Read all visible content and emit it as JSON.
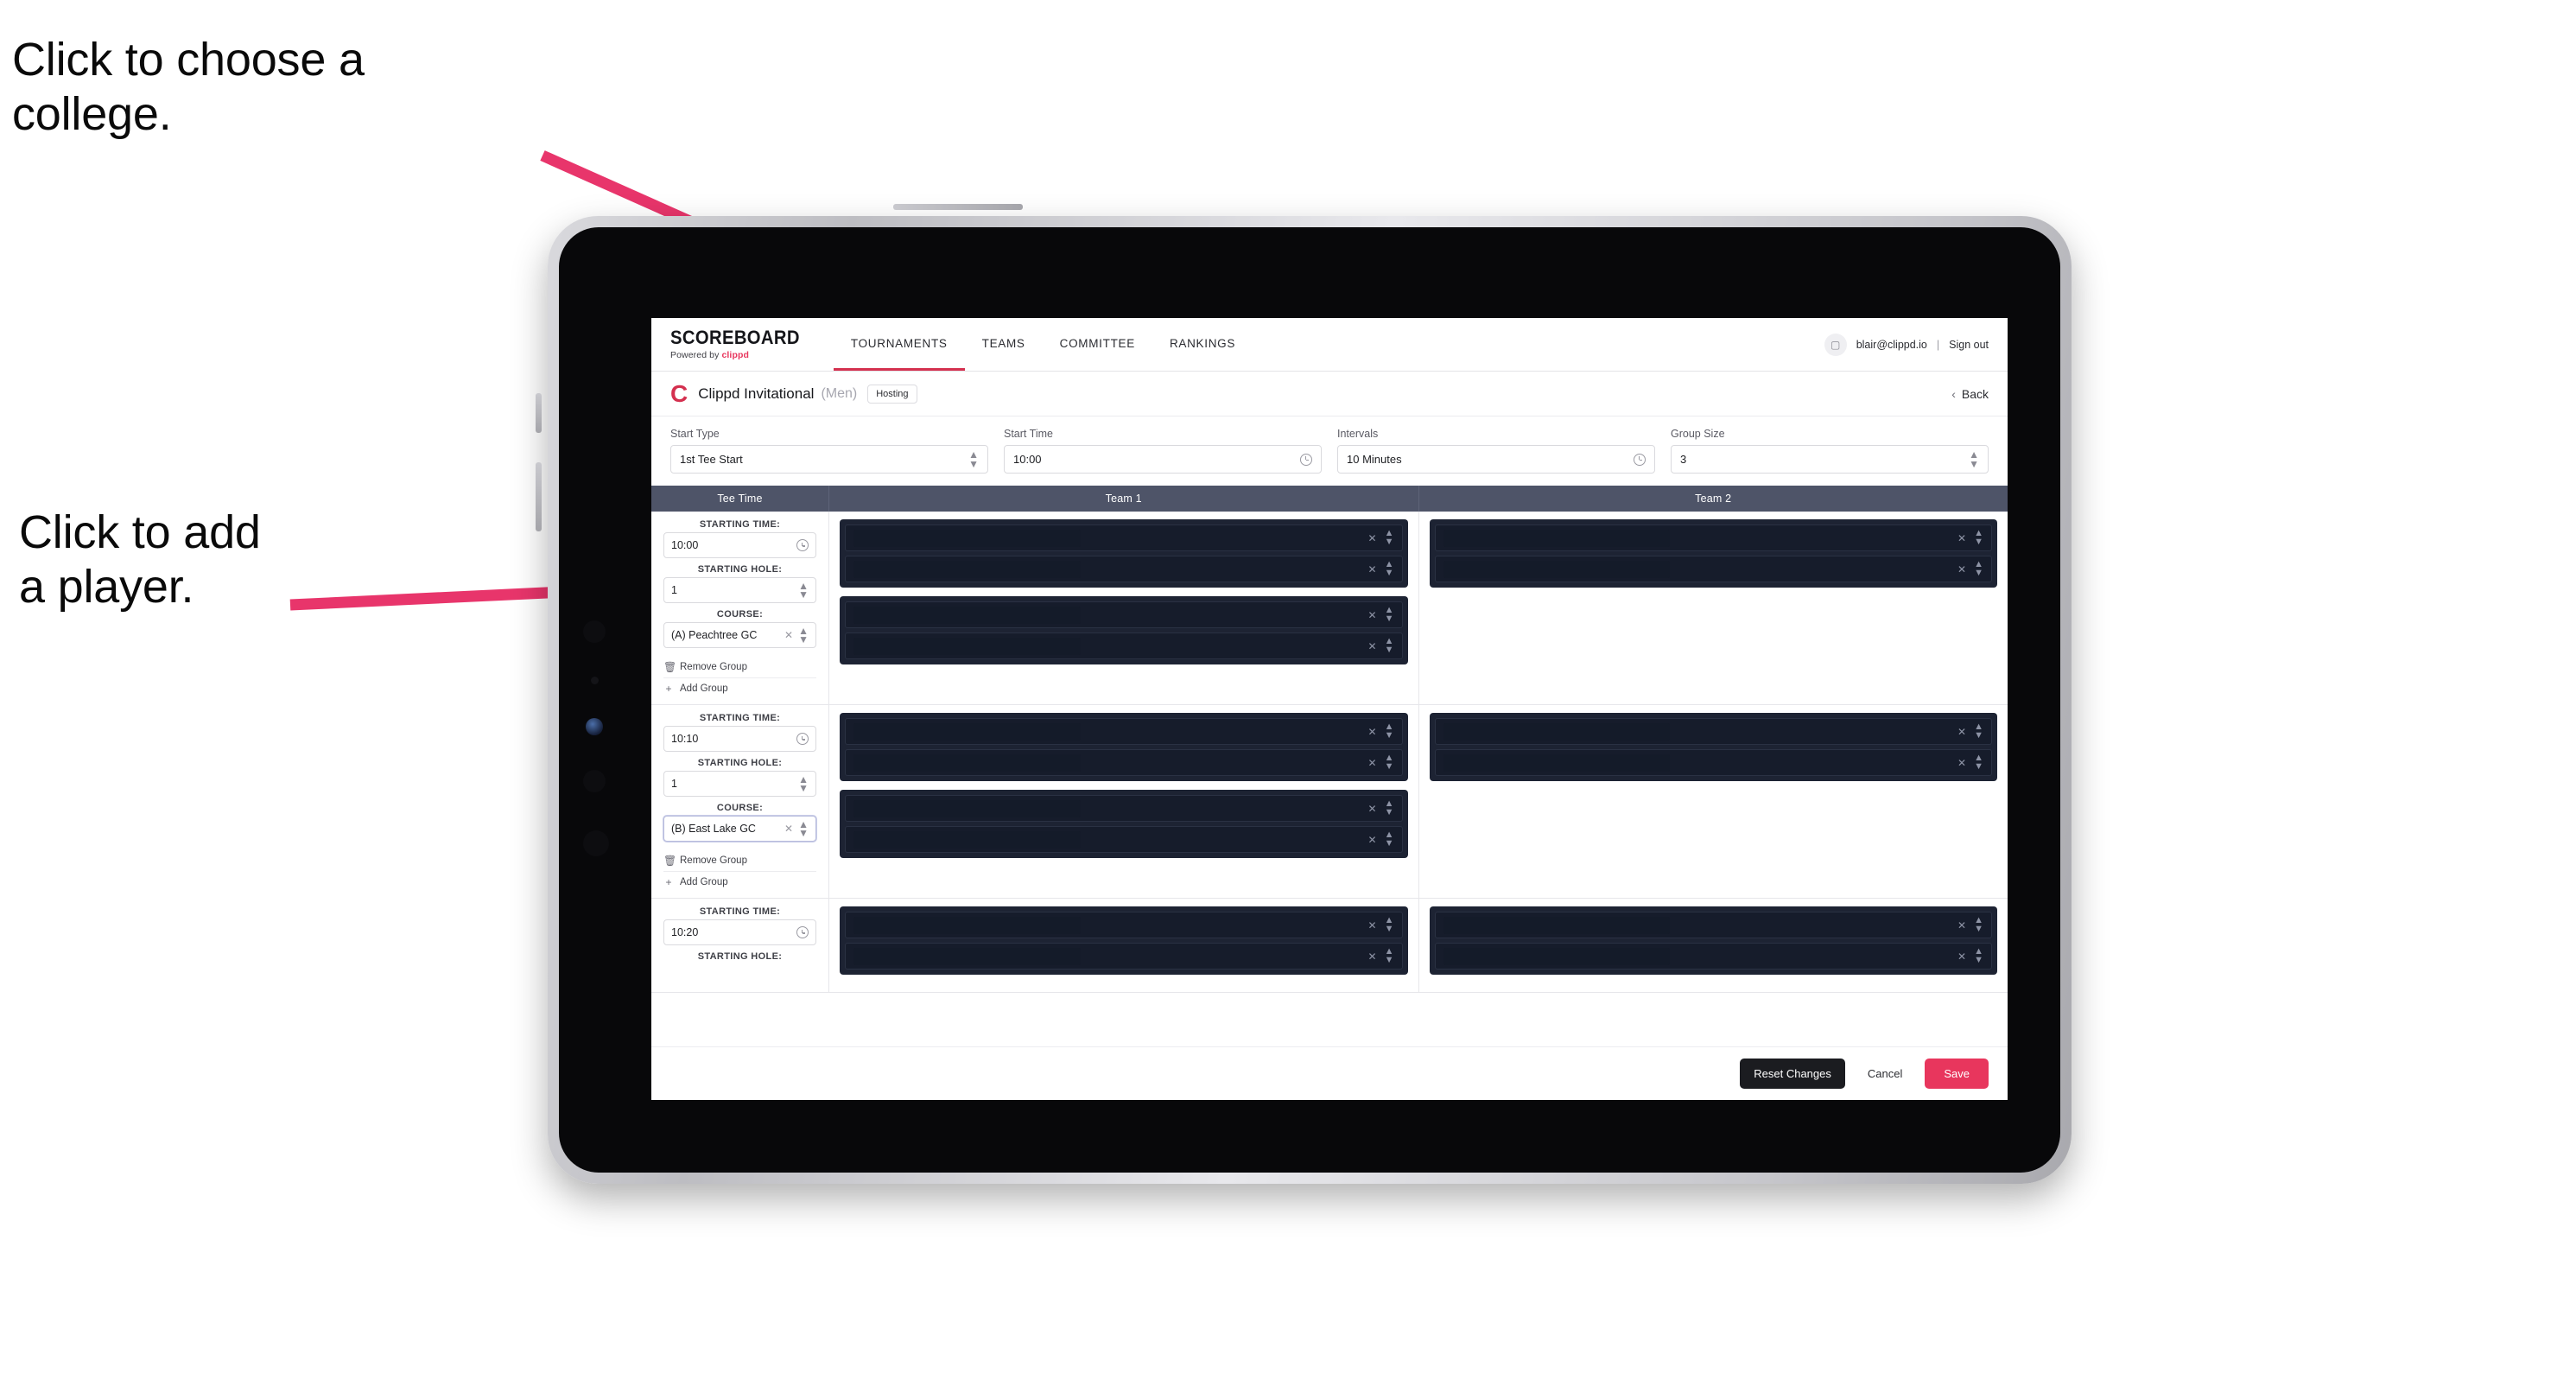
{
  "annotations": [
    {
      "id": "college",
      "text": "Click to choose a\ncollege."
    },
    {
      "id": "player",
      "text": "Click to add\na player."
    }
  ],
  "colors": {
    "accent": "#e8365d",
    "nav_active_underline": "#d4304f",
    "table_header_bg": "#4e5468",
    "slot_bg": "#1d2333",
    "save_button": "#e8365d",
    "reset_button": "#1b1c20",
    "arrow": "#e8356b"
  },
  "topnav": {
    "brand_word": "SCOREBOARD",
    "brand_sub_prefix": "Powered by ",
    "brand_sub_name": "clippd",
    "tabs": [
      {
        "label": "TOURNAMENTS",
        "active": true
      },
      {
        "label": "TEAMS",
        "active": false
      },
      {
        "label": "COMMITTEE",
        "active": false
      },
      {
        "label": "RANKINGS",
        "active": false
      }
    ],
    "avatar_icon": "user-avatar-icon",
    "email": "blair@clippd.io",
    "separator": "|",
    "sign_out": "Sign out"
  },
  "title_row": {
    "logo_letter": "C",
    "tournament_name": "Clippd Invitational",
    "gender": "(Men)",
    "role_chip": "Hosting",
    "back_chevron": "‹",
    "back_label": "Back"
  },
  "controls": [
    {
      "label": "Start Type",
      "value": "1st Tee Start",
      "affix": "stepper"
    },
    {
      "label": "Start Time",
      "value": "10:00",
      "affix": "clock"
    },
    {
      "label": "Intervals",
      "value": "10 Minutes",
      "affix": "clock"
    },
    {
      "label": "Group Size",
      "value": "3",
      "affix": "stepper"
    }
  ],
  "table": {
    "columns": [
      {
        "key": "tee",
        "label": "Tee Time"
      },
      {
        "key": "team1",
        "label": "Team 1"
      },
      {
        "key": "team2",
        "label": "Team 2"
      }
    ],
    "field_labels": {
      "starting_time": "STARTING TIME:",
      "starting_hole": "STARTING HOLE:",
      "course": "COURSE:"
    },
    "group_actions": {
      "remove": "Remove Group",
      "remove_icon": "trash-icon",
      "add": "Add Group",
      "add_icon": "plus-icon"
    },
    "rows": [
      {
        "starting_time": "10:00",
        "starting_hole": "1",
        "course": "(A) Peachtree GC",
        "course_focused": false,
        "team1_groups": [
          2,
          2
        ],
        "team2_groups": [
          2
        ],
        "truncated": false
      },
      {
        "starting_time": "10:10",
        "starting_hole": "1",
        "course": "(B) East Lake GC",
        "course_focused": true,
        "team1_groups": [
          2,
          2
        ],
        "team2_groups": [
          2
        ],
        "truncated": false
      },
      {
        "starting_time": "10:20",
        "starting_hole": "",
        "course": "",
        "course_focused": false,
        "team1_groups": [
          2
        ],
        "team2_groups": [
          2
        ],
        "truncated": true
      }
    ],
    "slot_clear_icon": "clear-x-icon",
    "slot_stepper_icon": "stepper-icon"
  },
  "footer": {
    "reset_label": "Reset Changes",
    "cancel_label": "Cancel",
    "save_label": "Save"
  }
}
